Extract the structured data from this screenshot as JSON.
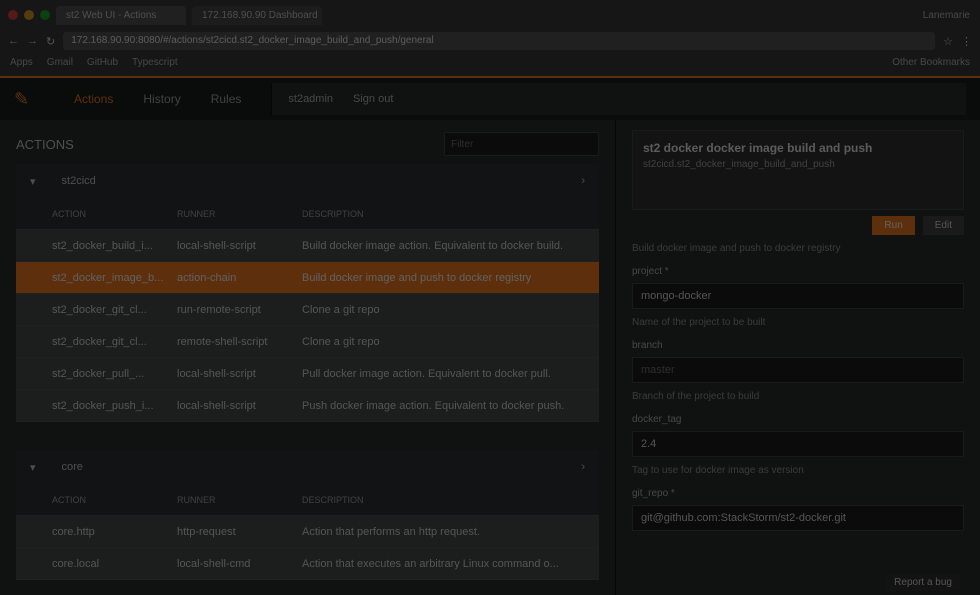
{
  "browser": {
    "tabs": [
      "st2 Web UI - Actions",
      "172.168.90.90 Dashboard"
    ],
    "user": "Lanemarie",
    "url": "172.168.90.90:8080/#/actions/st2cicd.st2_docker_image_build_and_push/general",
    "bookmarks": [
      "Apps",
      "Gmail",
      "GitHub",
      "Typescript"
    ],
    "other_bookmarks": "Other Bookmarks"
  },
  "nav": {
    "items": [
      "Actions",
      "History",
      "Rules"
    ],
    "user": "st2admin",
    "signout": "Sign out"
  },
  "actions": {
    "title": "ACTIONS",
    "filter_placeholder": "Filter",
    "packs": [
      {
        "name": "st2cicd",
        "columns": [
          "ACTION",
          "RUNNER",
          "DESCRIPTION"
        ],
        "rows": [
          [
            "st2_docker_build_i...",
            "local-shell-script",
            "Build docker image action. Equivalent to docker build."
          ],
          [
            "st2_docker_image_b...",
            "action-chain",
            "Build docker image and push to docker registry"
          ],
          [
            "st2_docker_git_cl...",
            "run-remote-script",
            "Clone a git repo"
          ],
          [
            "st2_docker_git_cl...",
            "remote-shell-script",
            "Clone a git repo"
          ],
          [
            "st2_docker_pull_...",
            "local-shell-script",
            "Pull docker image action. Equivalent to docker pull."
          ],
          [
            "st2_docker_push_i...",
            "local-shell-script",
            "Push docker image action. Equivalent to docker push."
          ]
        ]
      },
      {
        "name": "core",
        "columns": [
          "ACTION",
          "RUNNER",
          "DESCRIPTION"
        ],
        "rows": [
          [
            "core.http",
            "http-request",
            "Action that performs an http request."
          ],
          [
            "core.local",
            "local-shell-cmd",
            "Action that executes an arbitrary Linux command o..."
          ]
        ]
      }
    ],
    "selected_index": 1
  },
  "detail": {
    "title": "st2 docker docker image build and push",
    "description": "st2cicd.st2_docker_image_build_and_push",
    "run": "Run",
    "edit": "Edit",
    "summary": "Build docker image and push to docker registry",
    "fields": [
      {
        "label": "project *",
        "value": "mongo-docker",
        "hint": "Name of the project to be built"
      },
      {
        "label": "branch",
        "placeholder": "master",
        "hint": "Branch of the project to build"
      },
      {
        "label": "docker_tag",
        "value": "2.4",
        "hint": "Tag to use for docker image as version"
      },
      {
        "label": "git_repo *",
        "value": "git@github.com:StackStorm/st2-docker.git",
        "hint": ""
      }
    ]
  },
  "report": "Report a bug",
  "colors": {
    "accent": "#f47c20"
  }
}
